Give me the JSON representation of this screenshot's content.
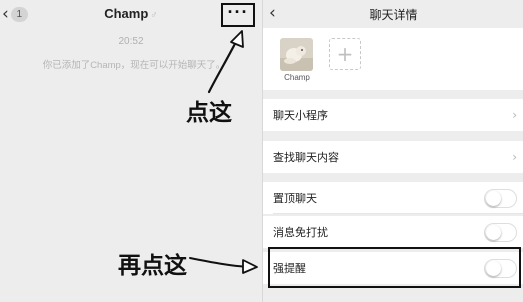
{
  "chat": {
    "back_symbol": "‹",
    "unread_count": "1",
    "title": "Champ",
    "title_suffix": "♂",
    "more_symbol": "···",
    "time": "20:52",
    "system_message": "你已添加了Champ，现在可以开始聊天了。"
  },
  "annotations": {
    "first": "点这",
    "second": "再点这"
  },
  "details": {
    "back_symbol": "‹",
    "title": "聊天详情",
    "member_name": "Champ",
    "add_symbol": "+",
    "mini_programs": "聊天小程序",
    "search_history": "查找聊天内容",
    "sticky": "置顶聊天",
    "mute": "消息免打扰",
    "strong_remind": "强提醒",
    "chevron": "›",
    "toggles": {
      "sticky_on": false,
      "mute_on": false,
      "strong_remind_on": false
    }
  },
  "colors": {
    "background": "#ededed",
    "cell": "#ffffff",
    "annotation_ink": "#111111",
    "muted_text": "#b5b5b5"
  },
  "icons": [
    "back-chevron-icon",
    "more-icon",
    "plus-icon",
    "chevron-right-icon",
    "avatar-image"
  ]
}
